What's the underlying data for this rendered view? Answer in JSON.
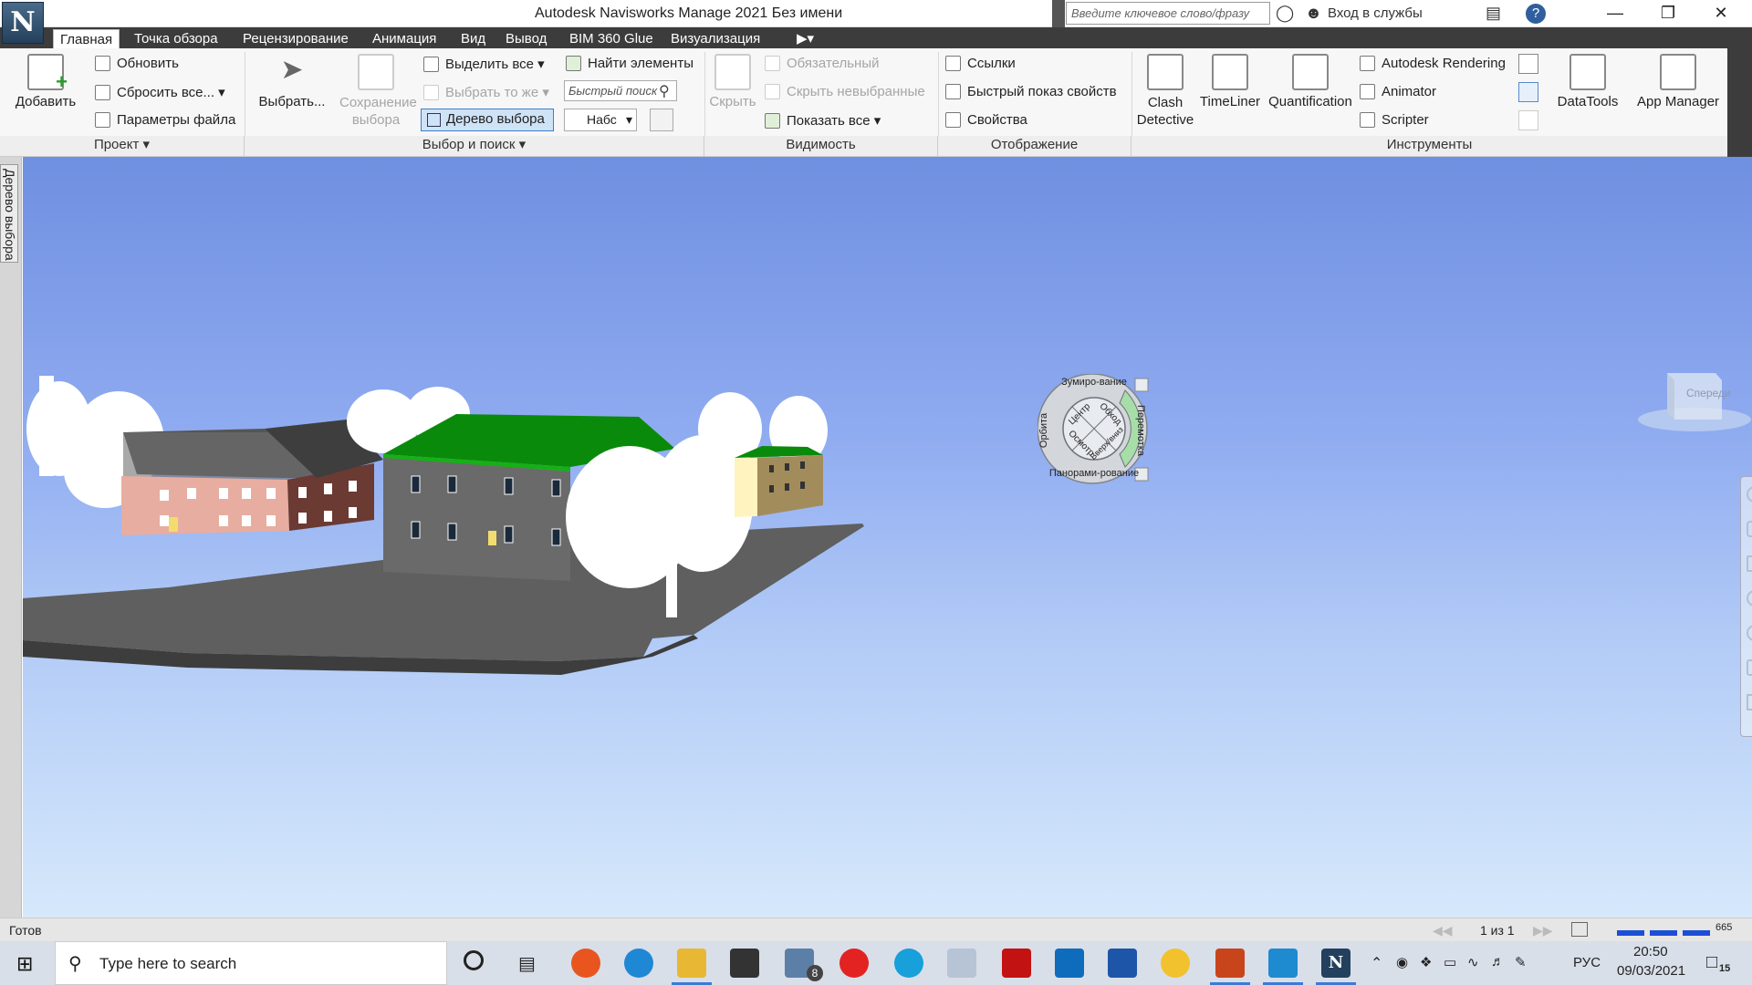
{
  "app": {
    "logo_letter": "N",
    "title": "Autodesk Navisworks Manage 2021    Без имени"
  },
  "titlebar": {
    "search_placeholder": "Введите ключевое слово/фразу",
    "signin": "Вход в службы",
    "help": "?"
  },
  "tabs": [
    {
      "label": "Главная",
      "active": true
    },
    {
      "label": "Точка обзора"
    },
    {
      "label": "Рецензирование"
    },
    {
      "label": "Анимация"
    },
    {
      "label": "Вид"
    },
    {
      "label": "Вывод"
    },
    {
      "label": "BIM 360 Glue"
    },
    {
      "label": "Визуализация"
    }
  ],
  "ribbon": {
    "project": {
      "add": "Добавить",
      "refresh": "Обновить",
      "reset_all": "Сбросить все...",
      "file_params": "Параметры файла",
      "footer": "Проект"
    },
    "select": {
      "select": "Выбрать...",
      "save_selection": "Сохранение выбора",
      "select_all": "Выделить все",
      "select_same": "Выбрать то же",
      "selection_tree": "Дерево выбора",
      "find_items": "Найти элементы",
      "quick_search": "Быстрый поиск",
      "set_value": "Набс",
      "footer": "Выбор и поиск"
    },
    "visibility": {
      "hide": "Скрыть",
      "required": "Обязательный",
      "hide_unselected": "Скрыть невыбранные",
      "show_all": "Показать все",
      "footer": "Видимость"
    },
    "display": {
      "links": "Ссылки",
      "quick_props": "Быстрый  показ свойств",
      "properties": "Свойства",
      "footer": "Отображение"
    },
    "tools": {
      "clash": "Clash Detective",
      "timeliner": "TimeLiner",
      "quantification": "Quantification",
      "autodesk_rendering": "Autodesk Rendering",
      "animator": "Animator",
      "scripter": "Scripter",
      "datatools": "DataTools",
      "app_manager": "App Manager",
      "footer": "Инструменты"
    }
  },
  "side_panel": {
    "tab": "Дерево выбора"
  },
  "viewcube": {
    "face": "Спереди"
  },
  "wheel": {
    "zoom": "Зумиро-вание",
    "orbit": "Орбита",
    "center": "Центр",
    "walk": "Обход",
    "rewind": "Перемотка",
    "look": "Осмотр",
    "updown": "Вверх/вниз",
    "pan": "Панорами-рование"
  },
  "status": {
    "text": "Готов",
    "page": "1 из 1",
    "memory": "665"
  },
  "taskbar": {
    "search_placeholder": "Type here to search",
    "mail_badge": "8",
    "lang": "РУС",
    "time": "20:50",
    "date": "09/03/2021",
    "notifications": "15"
  }
}
